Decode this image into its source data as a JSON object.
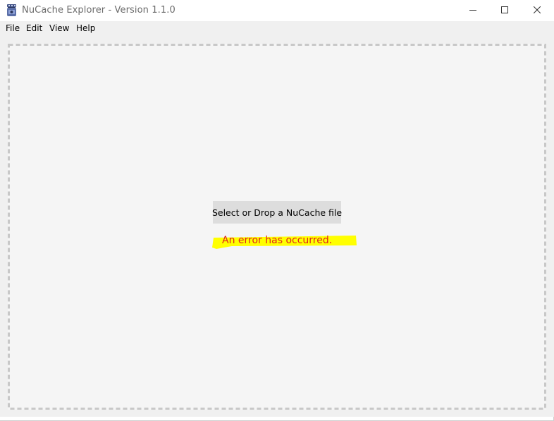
{
  "window": {
    "title": "NuCache Explorer - Version 1.1.0",
    "icon": "jar-icon",
    "controls": {
      "minimize": "minimize-icon",
      "maximize": "maximize-icon",
      "close": "close-icon"
    }
  },
  "menubar": {
    "items": [
      {
        "label": "File"
      },
      {
        "label": "Edit"
      },
      {
        "label": "View"
      },
      {
        "label": "Help"
      }
    ]
  },
  "main": {
    "select_button_label": "Select or Drop a NuCache file",
    "error_message": "An error has occurred."
  },
  "colors": {
    "error_text": "#e0251b",
    "highlight": "#ffff00",
    "drop_zone_background": "#f5f5f5",
    "drop_zone_border": "#c8c8c8",
    "button_background": "#dddddd"
  }
}
